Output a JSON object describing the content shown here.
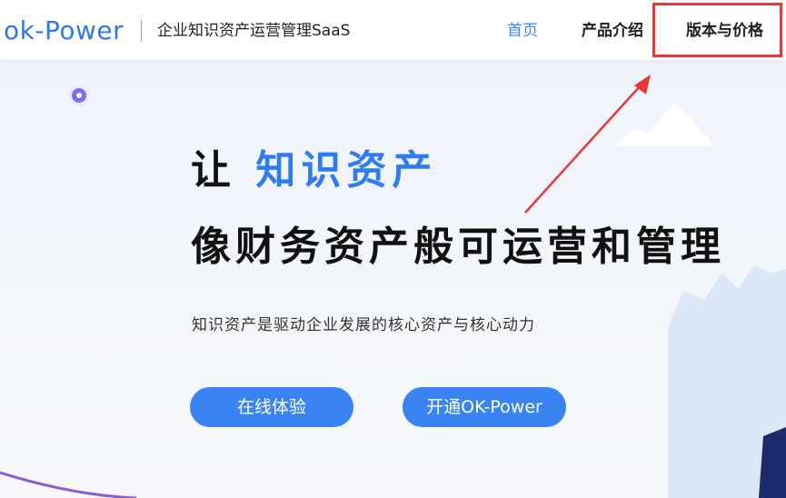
{
  "header": {
    "logo": "ok-Power",
    "tagline": "企业知识资产运营管理SaaS",
    "nav": [
      {
        "label": "首页",
        "active": true
      },
      {
        "label": "产品介绍",
        "active": false
      },
      {
        "label": "版本与价格",
        "active": false,
        "highlighted": true
      }
    ]
  },
  "hero": {
    "line1_prefix": "让",
    "line1_highlight": "知识资产",
    "line2": "像财务资产般可运营和管理",
    "subtitle": "知识资产是驱动企业发展的核心资产与核心动力",
    "buttons": [
      {
        "label": "在线体验"
      },
      {
        "label": "开通OK-Power"
      }
    ]
  },
  "colors": {
    "accent": "#2f7cf0",
    "button": "#3a83f2",
    "annotation": "#e53935"
  }
}
